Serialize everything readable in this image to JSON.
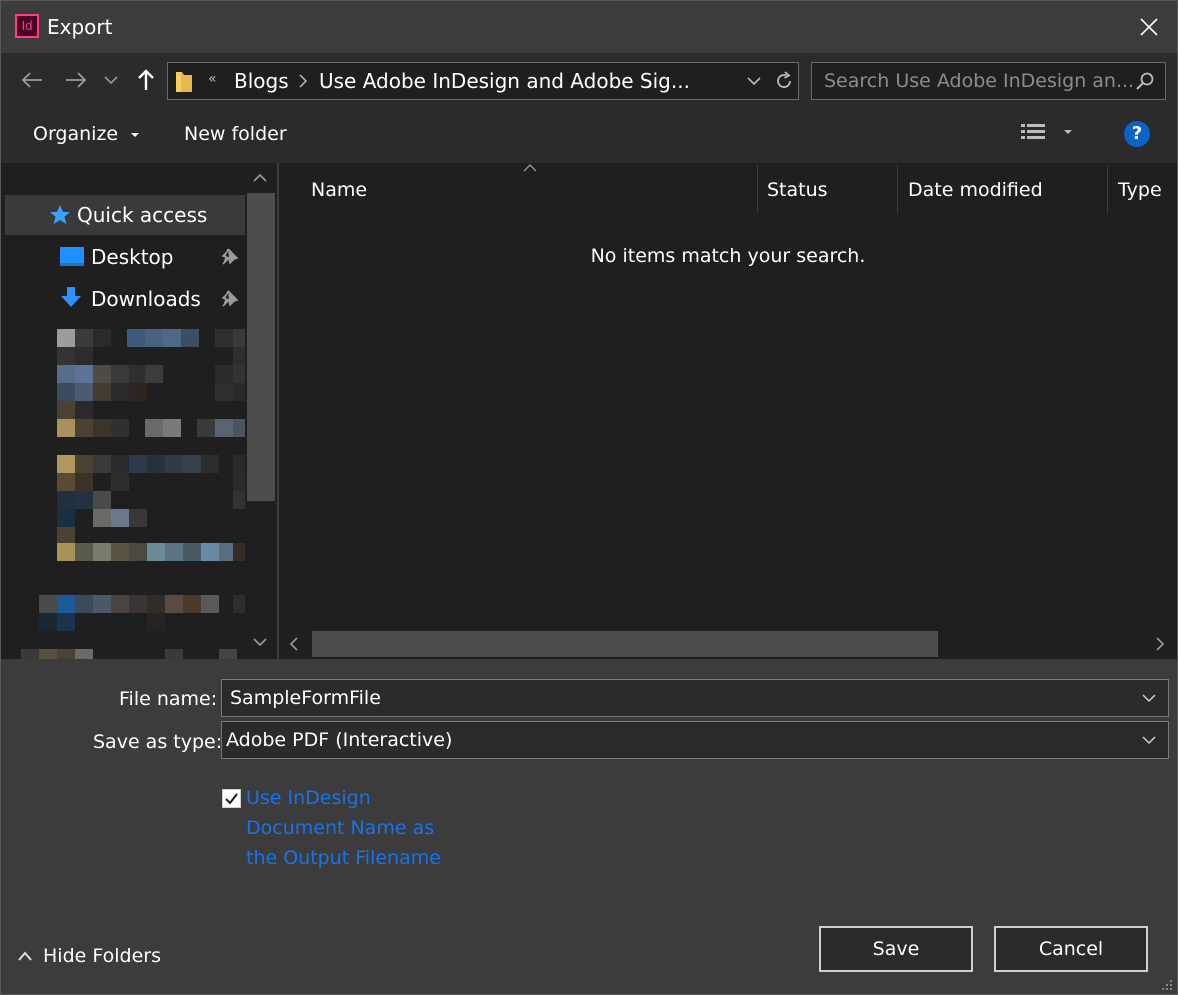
{
  "window": {
    "title": "Export",
    "app_icon_text": "Id"
  },
  "address": {
    "overflow": "«",
    "crumbs": [
      "Blogs",
      "Use Adobe InDesign and Adobe Sig..."
    ]
  },
  "search": {
    "placeholder": "Search Use Adobe InDesign an..."
  },
  "toolbar": {
    "organize": "Organize",
    "new_folder": "New folder",
    "help": "?"
  },
  "sidebar": {
    "items": [
      {
        "label": "Quick access",
        "icon": "star-icon"
      },
      {
        "label": "Desktop",
        "icon": "desktop-icon",
        "pinned": true
      },
      {
        "label": "Downloads",
        "icon": "downloads-icon",
        "pinned": true
      }
    ]
  },
  "filelist": {
    "columns": [
      "Name",
      "Status",
      "Date modified",
      "Type"
    ],
    "empty_message": "No items match your search."
  },
  "form": {
    "file_name_label": "File name:",
    "file_name_value": "SampleFormFile",
    "save_type_label": "Save as type:",
    "save_type_value": "Adobe PDF (Interactive)",
    "checkbox_label": "Use InDesign Document Name as the Output Filename",
    "checkbox_checked": true
  },
  "footer": {
    "hide_folders": "Hide Folders",
    "save": "Save",
    "cancel": "Cancel"
  },
  "colors": {
    "accent": "#1a73e8",
    "app_icon": "#ff3b8d",
    "help": "#0a64c8"
  }
}
